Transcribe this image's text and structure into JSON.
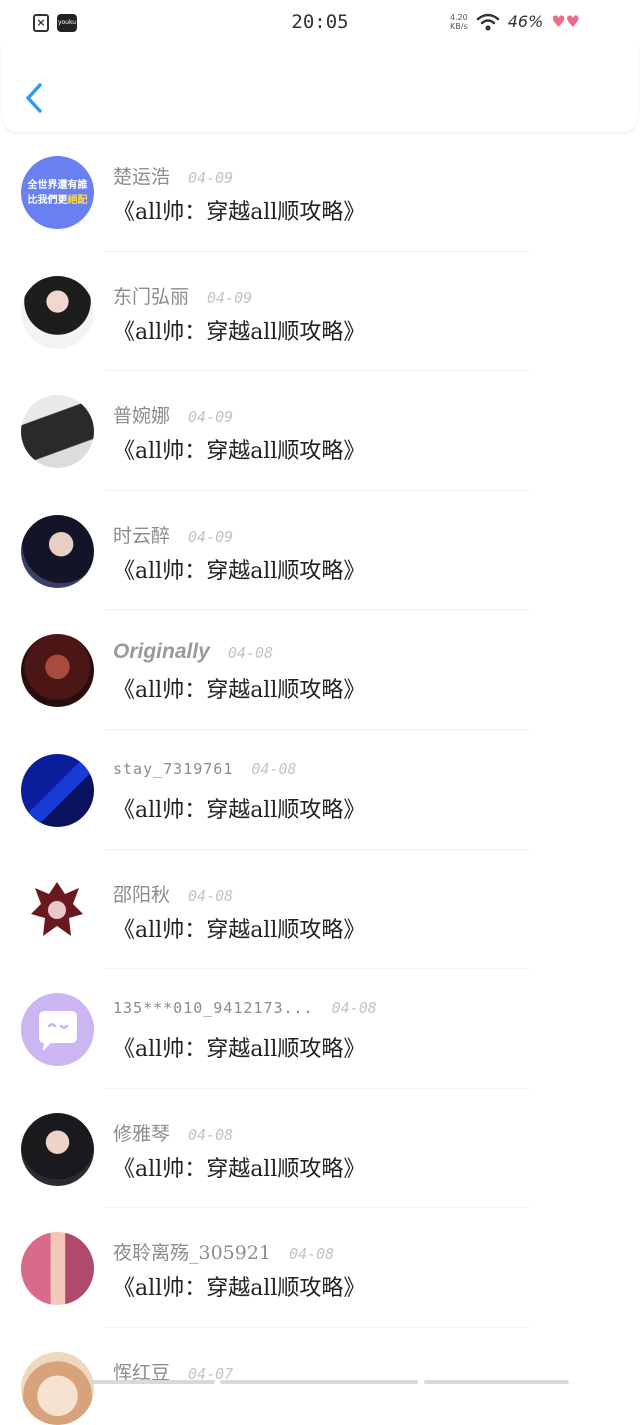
{
  "status_bar": {
    "time": "20:05",
    "net_speed_value": "4.20",
    "net_speed_unit": "KB/s",
    "battery": "46%",
    "app_icon_youku": "youku"
  },
  "header": {
    "back_icon": "chevron-left-icon"
  },
  "comments": [
    {
      "user": "楚运浩",
      "date": "04-09",
      "title": "《all帅：穿越all顺攻略》",
      "avatar": {
        "type": "text",
        "line1": "全世界還有誰",
        "line2a": "比我們更",
        "line2b": "絕配",
        "bg": "#6a7ff2"
      }
    },
    {
      "user": "东门弘丽",
      "date": "04-09",
      "title": "《all帅：穿越all顺攻略》",
      "avatar": {
        "type": "photo",
        "bg": "#2b2b2b"
      }
    },
    {
      "user": "普婉娜",
      "date": "04-09",
      "title": "《all帅：穿越all顺攻略》",
      "avatar": {
        "type": "photo",
        "bg": "#cfcfcf"
      }
    },
    {
      "user": "时云醉",
      "date": "04-09",
      "title": "《all帅：穿越all顺攻略》",
      "avatar": {
        "type": "photo",
        "bg": "#15182a"
      }
    },
    {
      "user": "Originally",
      "date": "04-08",
      "title": "《all帅：穿越all顺攻略》",
      "avatar": {
        "type": "photo",
        "bg": "#5a1d1d"
      }
    },
    {
      "user": "stay_7319761",
      "date": "04-08",
      "title": "《all帅：穿越all顺攻略》",
      "avatar": {
        "type": "photo",
        "bg": "#0a1a8a"
      }
    },
    {
      "user": "邵阳秋",
      "date": "04-08",
      "title": "《all帅：穿越all顺攻略》",
      "avatar": {
        "type": "emblem",
        "bg": "#ffffff"
      }
    },
    {
      "user": "135***010_9412173...",
      "date": "04-08",
      "title": "《all帅：穿越all顺攻略》",
      "avatar": {
        "type": "chat",
        "bg": "#c9b3f0"
      }
    },
    {
      "user": "修雅琴",
      "date": "04-08",
      "title": "《all帅：穿越all顺攻略》",
      "avatar": {
        "type": "photo",
        "bg": "#1e1e22"
      }
    },
    {
      "user": "夜聆离殇_305921",
      "date": "04-08",
      "title": "《all帅：穿越all顺攻略》",
      "avatar": {
        "type": "photo",
        "bg": "#c45a78"
      }
    },
    {
      "user": "恽红豆",
      "date": "04-07",
      "title": "",
      "avatar": {
        "type": "photo",
        "bg": "#e8c7a8"
      }
    }
  ]
}
